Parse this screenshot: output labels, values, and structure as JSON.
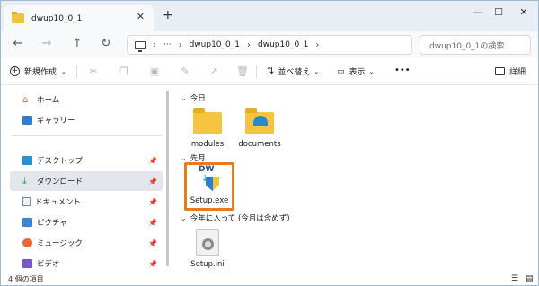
{
  "window": {
    "tab_title": "dwup10_0_1",
    "tab_close": "✕",
    "new_tab": "+",
    "minimize": "—",
    "maximize": "☐",
    "close": "✕"
  },
  "nav": {
    "back": "←",
    "forward": "→",
    "up": "↑",
    "refresh": "↻",
    "more": "···",
    "breadcrumb": [
      "dwup10_0_1",
      "dwup10_0_1"
    ],
    "search_placeholder": "dwup10_0_1の検索"
  },
  "toolbar": {
    "new_label": "新規作成",
    "sort_label": "並べ替え",
    "view_label": "表示",
    "more": "•••",
    "details_label": "詳細"
  },
  "sidebar": {
    "items": [
      {
        "label": "ホーム",
        "icon": "home-icon"
      },
      {
        "label": "ギャラリー",
        "icon": "gallery-icon"
      },
      {
        "label": "デスクトップ",
        "icon": "desktop-icon",
        "pinned": true
      },
      {
        "label": "ダウンロード",
        "icon": "download-icon",
        "pinned": true,
        "selected": true
      },
      {
        "label": "ドキュメント",
        "icon": "documents-icon",
        "pinned": true
      },
      {
        "label": "ピクチャ",
        "icon": "pictures-icon",
        "pinned": true
      },
      {
        "label": "ミュージック",
        "icon": "music-icon",
        "pinned": true
      },
      {
        "label": "ビデオ",
        "icon": "video-icon",
        "pinned": true
      }
    ]
  },
  "content": {
    "groups": [
      {
        "header": "今日",
        "files": [
          {
            "name": "modules",
            "type": "folder"
          },
          {
            "name": "documents",
            "type": "folder"
          }
        ]
      },
      {
        "header": "先月",
        "files": [
          {
            "name": "Setup.exe",
            "type": "exe",
            "logo_text": "DW"
          }
        ]
      },
      {
        "header": "今年に入って (今月は含めず)",
        "files": [
          {
            "name": "Setup.ini",
            "type": "ini"
          }
        ]
      }
    ]
  },
  "status": {
    "item_count": "4 個の項目"
  },
  "colors": {
    "highlight": "#e47b27",
    "folder": "#f6c343",
    "accent": "#2b89c9"
  }
}
